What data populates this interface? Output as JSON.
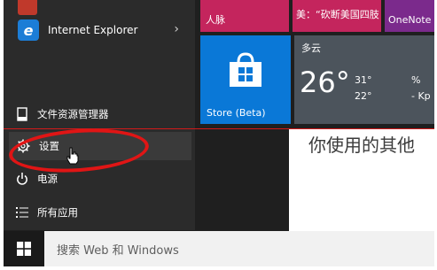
{
  "start_menu": {
    "top_item_icon": "app-icon",
    "ie": {
      "label": "Internet Explorer",
      "icon": "ie-icon",
      "chevron": "›"
    },
    "file_explorer": {
      "label": "文件资源管理器",
      "icon": "file-explorer-icon"
    },
    "settings": {
      "label": "设置",
      "icon": "gear-icon"
    },
    "power": {
      "label": "电源",
      "icon": "power-icon"
    },
    "all_apps": {
      "label": "所有应用",
      "icon": "list-icon"
    }
  },
  "tiles": {
    "contacts": {
      "label": "人脉"
    },
    "news": {
      "label": "美：“砍断美国四肢"
    },
    "onenote": {
      "label": "OneNote"
    },
    "store": {
      "label": "Store (Beta)",
      "icon": "store-bag-icon"
    },
    "weather": {
      "condition": "多云",
      "temperature": "26°",
      "high": "31°",
      "low": "22°",
      "humidity": "%",
      "wind": "- Kp"
    }
  },
  "background_text": "你使用的其他",
  "taskbar": {
    "start_icon": "windows-logo-icon",
    "search_placeholder": "搜索 Web 和 Windows"
  },
  "annotation": {
    "ring_color": "#e01515"
  },
  "colors": {
    "store_tile": "#0a78d7",
    "pink_tile": "#c4255d",
    "onenote_tile": "#7b2a8c",
    "weather_tile": "#4c545c"
  }
}
